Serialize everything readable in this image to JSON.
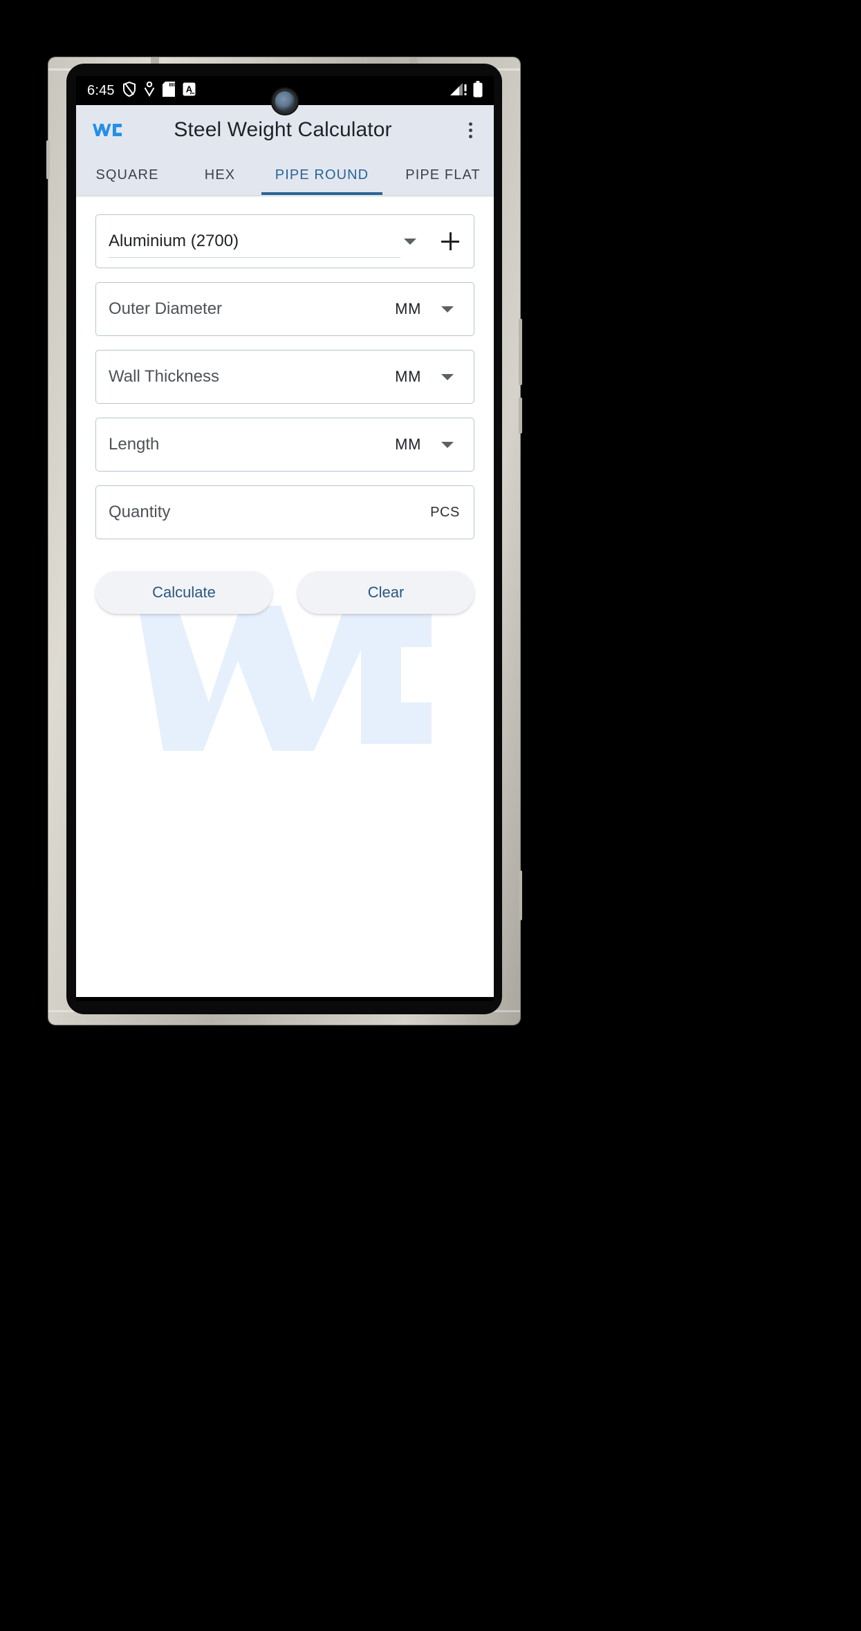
{
  "status_bar": {
    "clock": "6:45",
    "left_icons": [
      "shield-icon",
      "heart-pulse-icon",
      "sd-card-icon",
      "a-badge-icon"
    ],
    "right_icons": [
      "signal-warning-icon",
      "battery-full-icon"
    ]
  },
  "app_bar": {
    "logo": "wc-logo-icon",
    "title": "Steel Weight Calculator",
    "overflow": "more-vertical-icon"
  },
  "tabs": [
    {
      "label": "SQUARE",
      "active": false
    },
    {
      "label": "HEX",
      "active": false
    },
    {
      "label": "PIPE ROUND",
      "active": true
    },
    {
      "label": "PIPE FLAT",
      "active": false
    }
  ],
  "form": {
    "material": {
      "value": "Aluminium (2700)",
      "dropdown_icon": "chevron-down-icon",
      "add_icon": "plus-icon"
    },
    "fields": [
      {
        "placeholder": "Outer Diameter",
        "value": "",
        "unit": "MM",
        "has_unit_dropdown": true
      },
      {
        "placeholder": "Wall Thickness",
        "value": "",
        "unit": "MM",
        "has_unit_dropdown": true
      },
      {
        "placeholder": "Length",
        "value": "",
        "unit": "MM",
        "has_unit_dropdown": true
      },
      {
        "placeholder": "Quantity",
        "value": "",
        "unit": "PCS",
        "has_unit_dropdown": false
      }
    ]
  },
  "actions": {
    "calculate": "Calculate",
    "clear": "Clear"
  },
  "colors": {
    "accent": "#2a6496",
    "appbar_bg": "#e2e7ef",
    "logo_blue": "#2490e8",
    "button_text": "#2a5681",
    "field_border": "#b9c6cf"
  }
}
